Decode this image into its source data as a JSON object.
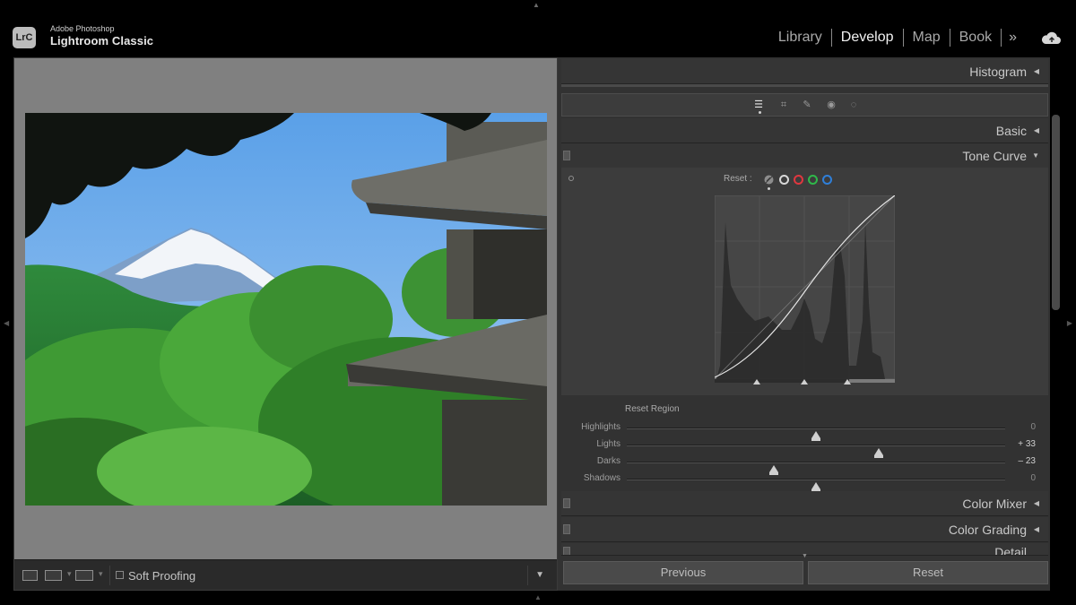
{
  "app": {
    "badge": "LrC",
    "vendor": "Adobe Photoshop",
    "name": "Lightroom Classic"
  },
  "modules": [
    {
      "label": "Library",
      "active": false
    },
    {
      "label": "Develop",
      "active": true
    },
    {
      "label": "Map",
      "active": false
    },
    {
      "label": "Book",
      "active": false
    }
  ],
  "modules_more": "»",
  "icons": {
    "cloud": "cloud-sync-icon",
    "tools": [
      "edit-sliders-icon",
      "crop-icon",
      "healing-icon",
      "red-eye-icon",
      "masking-icon"
    ]
  },
  "left_toolbar": {
    "soft_proofing_label": "Soft Proofing"
  },
  "panels": {
    "histogram": "Histogram",
    "basic": "Basic",
    "tone_curve": "Tone Curve",
    "color_mixer": "Color Mixer",
    "color_grading": "Color Grading",
    "detail": "Detail"
  },
  "tone_curve": {
    "reset_label": "Reset :",
    "channels": [
      {
        "name": "parametric",
        "color": "#b0b0b0"
      },
      {
        "name": "rgb",
        "color": "#d8d8d8"
      },
      {
        "name": "red",
        "color": "#e0373f"
      },
      {
        "name": "green",
        "color": "#2fb84a"
      },
      {
        "name": "blue",
        "color": "#2f7fd8"
      }
    ],
    "region_title": "Reset Region",
    "sliders": [
      {
        "label": "Highlights",
        "value": "0",
        "fraction": 0.5
      },
      {
        "label": "Lights",
        "value": "+ 33",
        "fraction": 0.665
      },
      {
        "label": "Darks",
        "value": "– 23",
        "fraction": 0.385
      },
      {
        "label": "Shadows",
        "value": "0",
        "fraction": 0.5
      }
    ]
  },
  "buttons": {
    "previous": "Previous",
    "reset": "Reset"
  }
}
